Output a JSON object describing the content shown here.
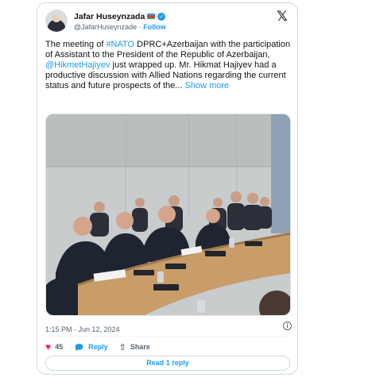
{
  "author": {
    "display_name": "Jafar Huseynzada",
    "handle": "@JafarHuseynzade",
    "separator": "·",
    "follow_label": "Follow",
    "flag_colors": [
      "#00b5e2",
      "#ef3340",
      "#509e2f"
    ],
    "verified_icon": "verified-badge-icon"
  },
  "tweet": {
    "t1": "The meeting of ",
    "t2": "#NATO",
    "t3": " DPRC+Azerbaijan with the participation of Assistant to the  President of the Republic of Azerbaijan, ",
    "t4": "@HikmetHajiyev",
    "t5": " just wrapped up. Mr. Hikmat Hajiyev had a productive discussion with Allied Nations regarding the current status and future prospects of the...",
    "show_more": "Show more"
  },
  "meta": {
    "timestamp": "1:15 PM · Jun 12, 2024"
  },
  "actions": {
    "likes": "45",
    "reply_label": "Reply",
    "share_label": "Share"
  },
  "read_reply_label": "Read 1 reply",
  "colors": {
    "accent": "#1d9bf0",
    "like": "#f91880",
    "text": "#0f1419",
    "muted": "#536471",
    "border": "#cfd9de"
  }
}
